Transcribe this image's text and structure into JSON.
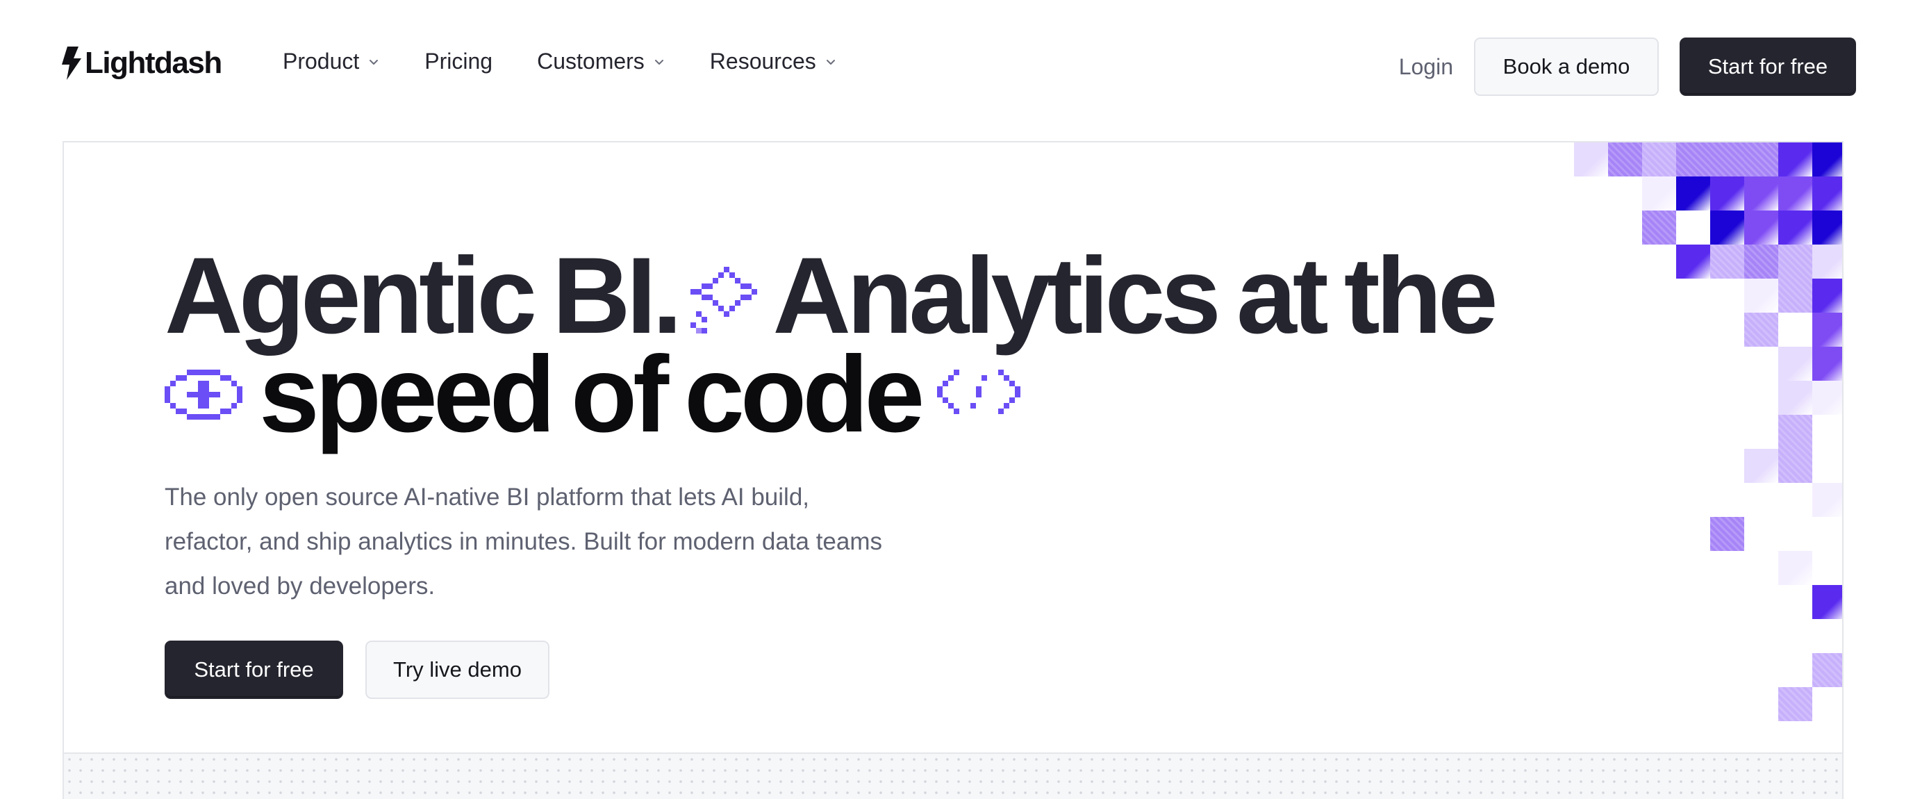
{
  "nav": {
    "logo_text": "Lightdash",
    "items": [
      {
        "label": "Product",
        "has_dropdown": true
      },
      {
        "label": "Pricing",
        "has_dropdown": false
      },
      {
        "label": "Customers",
        "has_dropdown": true
      },
      {
        "label": "Resources",
        "has_dropdown": true
      }
    ],
    "login_label": "Login",
    "book_demo_label": "Book a demo",
    "start_free_label": "Start for free"
  },
  "hero": {
    "headline_words_line1": [
      "Agentic",
      "BI.",
      "Analytics",
      "at",
      "the"
    ],
    "headline_words_line2": [
      "speed",
      "of",
      "code"
    ],
    "subtext": "The only open source AI-native BI platform that lets AI build, refactor, and ship analytics in minutes. Built for modern data teams and loved by developers.",
    "primary_cta": "Start for free",
    "secondary_cta": "Try live demo"
  },
  "icons": {
    "logo": "lightning-bolt-icon",
    "dropdown": "chevron-down-icon",
    "headline_glyphs": [
      "pixel-sparkle-icon",
      "pixel-eye-icon",
      "pixel-code-brackets-icon"
    ]
  },
  "colors": {
    "accent_purple": "#6b4ef5",
    "dark_button": "#25252f",
    "text_muted": "#5e6170",
    "mosaic_palette": [
      "#1c04d6",
      "#5a2bef",
      "#7f4cf4",
      "#a684f7",
      "#c7b0fb",
      "#e6dcfe",
      "#f4efff"
    ]
  }
}
